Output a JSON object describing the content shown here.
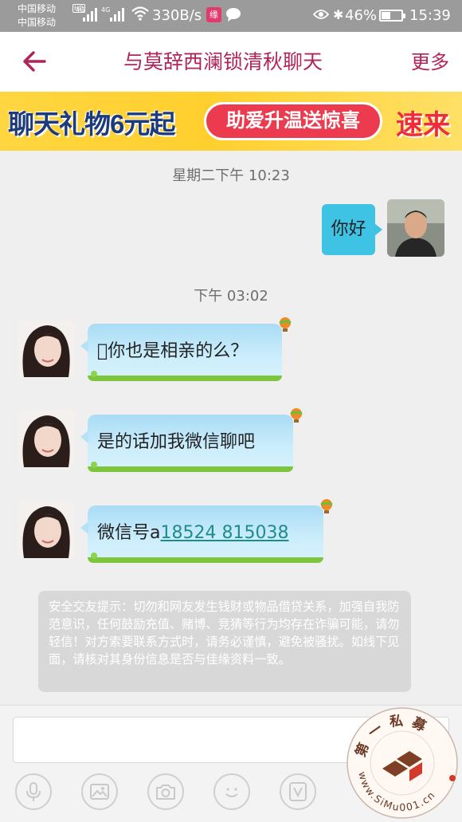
{
  "status_bar": {
    "carrier_1": "中国移动",
    "carrier_2": "中国移动",
    "hd_badge": "HD",
    "network_1": "4G",
    "network_2": "4G",
    "speed": "330B/s",
    "app_badge_text": "缘",
    "battery_percent": "46%",
    "battery_level": 0.46,
    "time": "15:39",
    "icons": [
      "signal-icon",
      "wifi-icon",
      "message-icon",
      "eye-icon",
      "bluetooth-icon",
      "battery-icon"
    ]
  },
  "header": {
    "title": "与莫辞西澜锁清秋聊天",
    "more_label": "更多",
    "back_icon": "back-arrow-icon",
    "accent_color": "#b0245a"
  },
  "banner": {
    "left_text": "聊天礼物6元起",
    "pill_text": "助爱升温送惊喜",
    "right_text": "速来"
  },
  "chat": {
    "timestamp_1": "星期二下午 10:23",
    "sent_message": "你好",
    "timestamp_2": "下午 03:02",
    "received": [
      {
        "text": "\u0000你也是相亲的么？"
      },
      {
        "text": "是的话加我微信聊吧"
      },
      {
        "prefix": "微信号a",
        "link": "18524   815038"
      }
    ],
    "bubble_color": "#3fc3e4"
  },
  "notice": {
    "text": "安全交友提示：切勿和网友发生钱财或物品借贷关系，加强自我防范意识，任何鼓励充值、赌博、竞猜等行为均存在诈骗可能，请勿轻信！对方索要联系方式时，请务必谨慎，避免被骚扰。如线下见面，请核对其身份信息是否与佳缘资料一致。"
  },
  "input_bar": {
    "placeholder": "",
    "tools": [
      "microphone-icon",
      "image-icon",
      "camera-icon",
      "emoji-icon",
      "video-icon"
    ]
  },
  "watermark": {
    "top_text": "第一私募",
    "bottom_text": "www.SiMu001.cn"
  }
}
